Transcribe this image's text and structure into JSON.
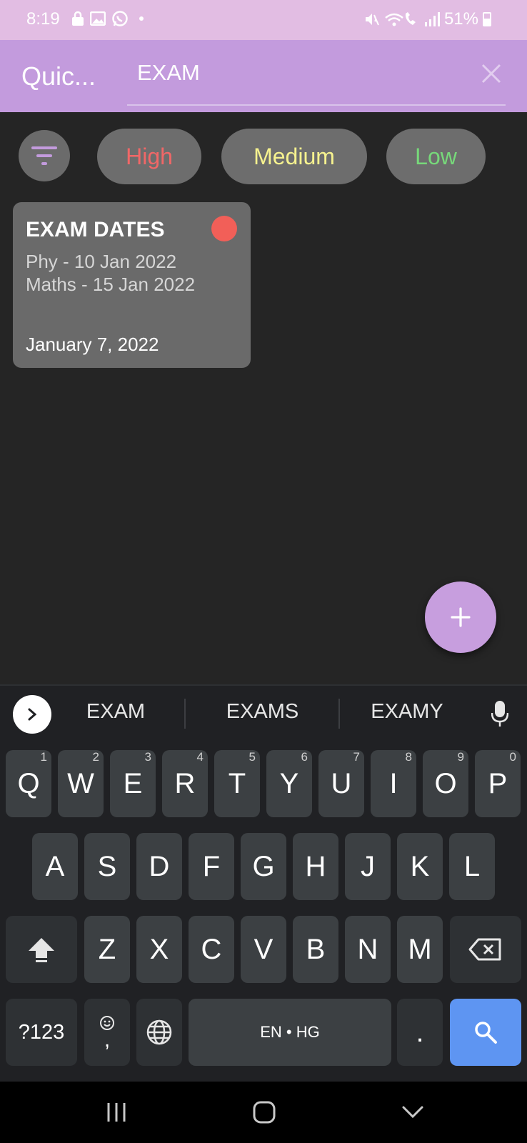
{
  "status_bar": {
    "time": "8:19",
    "battery": "51%",
    "icons_left": [
      "lock-icon",
      "image-icon",
      "whatsapp-icon",
      "dot-icon"
    ],
    "icons_right": [
      "mute-icon",
      "wifi-call-icon",
      "signal-icon",
      "battery-icon"
    ]
  },
  "app_bar": {
    "title": "Quic...",
    "search_value": "EXAM",
    "clear_icon": "close-icon"
  },
  "filters": {
    "filter_icon": "filter-icon",
    "chips": [
      {
        "label": "High",
        "color": "#f16767"
      },
      {
        "label": "Medium",
        "color": "#f6f28f"
      },
      {
        "label": "Low",
        "color": "#77d87a"
      }
    ]
  },
  "notes": [
    {
      "title": "EXAM DATES",
      "lines": [
        "Phy - 10 Jan 2022",
        "Maths - 15 Jan 2022"
      ],
      "date": "January 7, 2022",
      "priority": "High",
      "priority_color": "#f25f58"
    }
  ],
  "fab": {
    "icon": "plus-icon",
    "label": "+"
  },
  "keyboard": {
    "suggestions": [
      "EXAM",
      "EXAMS",
      "EXAMY"
    ],
    "row1": [
      {
        "key": "Q",
        "hint": "1"
      },
      {
        "key": "W",
        "hint": "2"
      },
      {
        "key": "E",
        "hint": "3"
      },
      {
        "key": "R",
        "hint": "4"
      },
      {
        "key": "T",
        "hint": "5"
      },
      {
        "key": "Y",
        "hint": "6"
      },
      {
        "key": "U",
        "hint": "7"
      },
      {
        "key": "I",
        "hint": "8"
      },
      {
        "key": "O",
        "hint": "9"
      },
      {
        "key": "P",
        "hint": "0"
      }
    ],
    "row2": [
      "A",
      "S",
      "D",
      "F",
      "G",
      "H",
      "J",
      "K",
      "L"
    ],
    "row3": [
      "Z",
      "X",
      "C",
      "V",
      "B",
      "N",
      "M"
    ],
    "symbols_label": "?123",
    "comma_label": ",",
    "space_label": "EN • HG",
    "period_label": "."
  },
  "nav_bar": {
    "icons": [
      "recents-icon",
      "home-icon",
      "back-icon"
    ]
  }
}
